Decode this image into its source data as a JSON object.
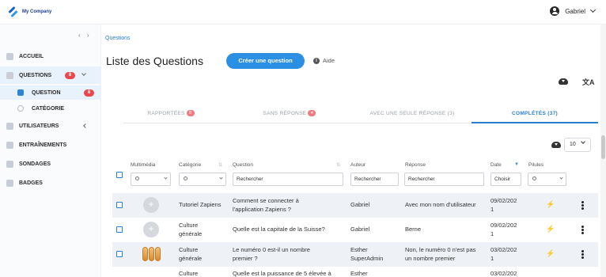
{
  "app": {
    "company": "My Company",
    "user": "Gabriel"
  },
  "sidebar": {
    "items": [
      {
        "label": "ACCUEIL"
      },
      {
        "label": "QUESTIONS",
        "badge": "8"
      },
      {
        "label": "QUESTION",
        "badge": "8"
      },
      {
        "label": "CATÉGORIE"
      },
      {
        "label": "UTILISATEURS"
      },
      {
        "label": "ENTRAÎNEMENTS"
      },
      {
        "label": "SONDAGES"
      },
      {
        "label": "BADGES"
      }
    ]
  },
  "main": {
    "breadcrumb": "Questions",
    "title": "Liste des Questions",
    "create_label": "Créer une question",
    "help_label": "Aide",
    "tabs": [
      {
        "label": "RAPPORTÉES",
        "badge": "8"
      },
      {
        "label": "SANS RÉPONSE",
        "badge": "4"
      },
      {
        "label": "AVEC UNE SEULE RÉPONSE (3)"
      },
      {
        "label": "COMPLÉTÉS (37)"
      }
    ],
    "page_size": "10"
  },
  "table": {
    "headers": {
      "media": "Multimédia",
      "category": "Catégorie",
      "question": "Question",
      "author": "Auteur",
      "answer": "Réponse",
      "date": "Date",
      "pills": "Pilules"
    },
    "filters": {
      "question": "Rechercher",
      "author": "Rechercher",
      "answer": "Rechercher",
      "date": "Choisir"
    },
    "rows": [
      {
        "category": "Tutoriel Zapiens",
        "question_l1": "Comment se connecter à",
        "question_l2": "l'application Zapiens ?",
        "author_l1": "Gabriel",
        "author_l2": "",
        "answer_l1": "Avec mon nom d'utilisateur",
        "answer_l2": "",
        "date_l1": "09/02/202",
        "date_l2": "1"
      },
      {
        "category_l1": "Culture",
        "category_l2": "générale",
        "question_l1": "Quelle est la capitale de la Suisse?",
        "author_l1": "Gabriel",
        "answer_l1": "Berne",
        "date_l1": "09/02/202",
        "date_l2": "1"
      },
      {
        "category_l1": "Culture",
        "category_l2": "générale",
        "question_l1": "Le numéro 0 est-il un nombre",
        "question_l2": "premier ?",
        "author_l1": "Esther",
        "author_l2": "SuperAdmin",
        "answer_l1": "Non, le numéro 0 n'est pas",
        "answer_l2": "un nombre premier",
        "date_l1": "03/02/202",
        "date_l2": "1"
      },
      {
        "category_l1": "Culture",
        "question_l1": "Quelle est la puissance de 5 élevée à",
        "author_l1": "Esther",
        "date_l1": "03/02/202"
      }
    ]
  }
}
